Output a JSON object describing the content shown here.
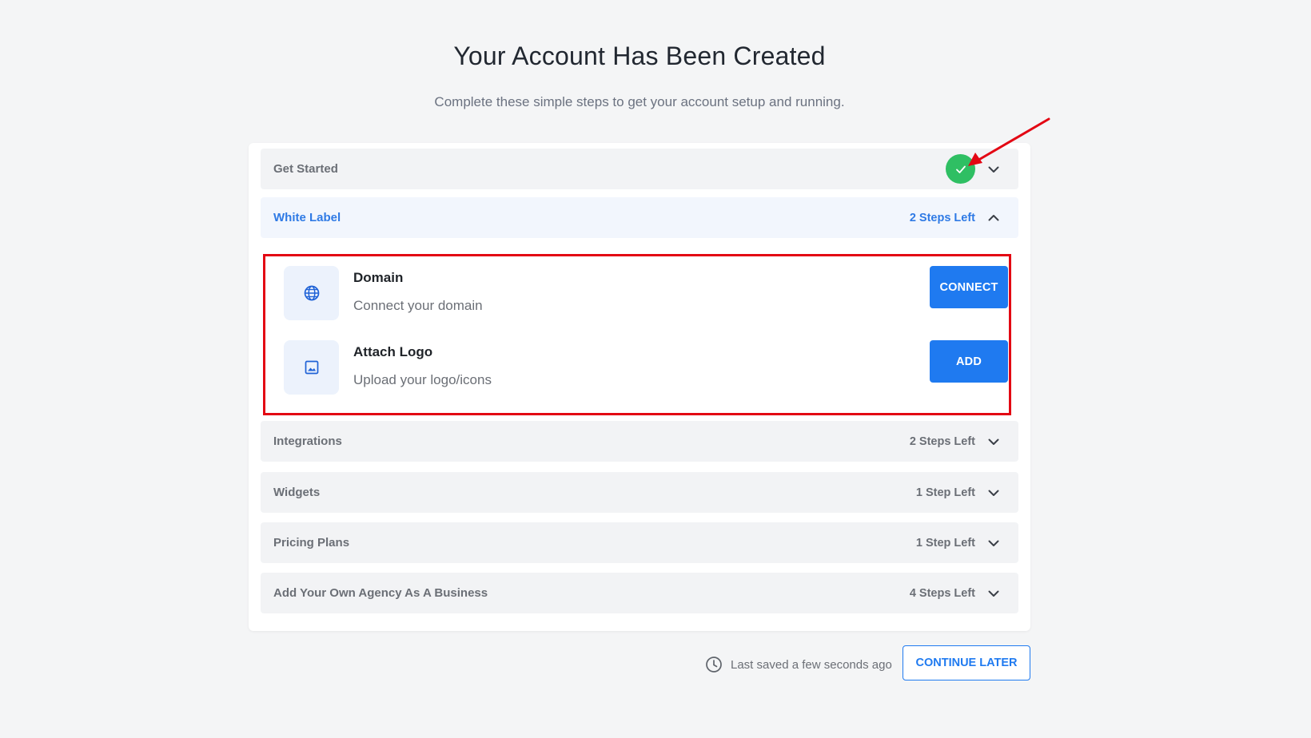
{
  "header": {
    "title": "Your Account Has Been Created",
    "subtitle": "Complete these simple steps to get your account setup and running."
  },
  "sections": [
    {
      "title": "Get Started",
      "status": "completed",
      "expanded": false
    },
    {
      "title": "White Label",
      "steps_left": "2 Steps Left",
      "expanded": true
    },
    {
      "title": "Integrations",
      "steps_left": "2 Steps Left",
      "expanded": false
    },
    {
      "title": "Widgets",
      "steps_left": "1 Step Left",
      "expanded": false
    },
    {
      "title": "Pricing Plans",
      "steps_left": "1 Step Left",
      "expanded": false
    },
    {
      "title": "Add Your Own Agency As A Business",
      "steps_left": "4 Steps Left",
      "expanded": false
    }
  ],
  "white_label_steps": [
    {
      "title": "Domain",
      "description": "Connect your domain",
      "icon": "globe-icon",
      "button": "CONNECT"
    },
    {
      "title": "Attach Logo",
      "description": "Upload your logo/icons",
      "icon": "image-icon",
      "button": "ADD"
    }
  ],
  "footer": {
    "saved_text": "Last saved a few seconds ago",
    "continue_label": "CONTINUE LATER"
  },
  "colors": {
    "accent": "#1f7af0",
    "success": "#2fbf63",
    "annotation": "#e30613",
    "background": "#f4f5f6"
  }
}
